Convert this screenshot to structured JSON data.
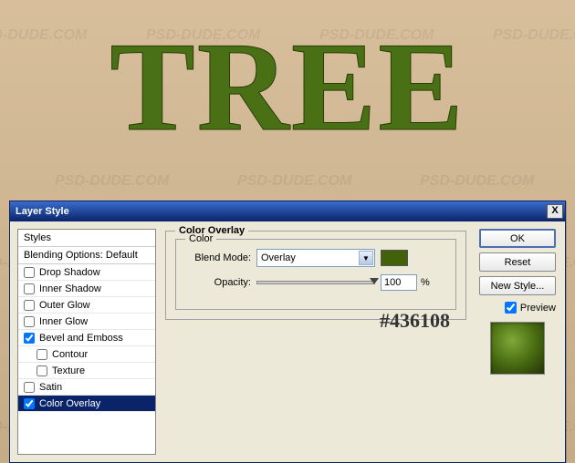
{
  "canvas": {
    "text": "TREE",
    "watermark": "PSD-DUDE.COM"
  },
  "dialog": {
    "title": "Layer Style",
    "close": "X",
    "styles_header": "Styles",
    "blending_options": "Blending Options: Default",
    "items": [
      {
        "label": "Drop Shadow",
        "checked": false,
        "indent": false
      },
      {
        "label": "Inner Shadow",
        "checked": false,
        "indent": false
      },
      {
        "label": "Outer Glow",
        "checked": false,
        "indent": false
      },
      {
        "label": "Inner Glow",
        "checked": false,
        "indent": false
      },
      {
        "label": "Bevel and Emboss",
        "checked": true,
        "indent": false
      },
      {
        "label": "Contour",
        "checked": false,
        "indent": true
      },
      {
        "label": "Texture",
        "checked": false,
        "indent": true
      },
      {
        "label": "Satin",
        "checked": false,
        "indent": false
      },
      {
        "label": "Color Overlay",
        "checked": true,
        "indent": false,
        "selected": true
      }
    ],
    "section_title": "Color Overlay",
    "color_group": "Color",
    "blend_mode_label": "Blend Mode:",
    "blend_mode_value": "Overlay",
    "opacity_label": "Opacity:",
    "opacity_value": "100",
    "opacity_unit": "%",
    "hex": "#436108",
    "swatch_color": "#436108",
    "buttons": {
      "ok": "OK",
      "reset": "Reset",
      "new_style": "New Style..."
    },
    "preview_label": "Preview",
    "preview_checked": true
  }
}
